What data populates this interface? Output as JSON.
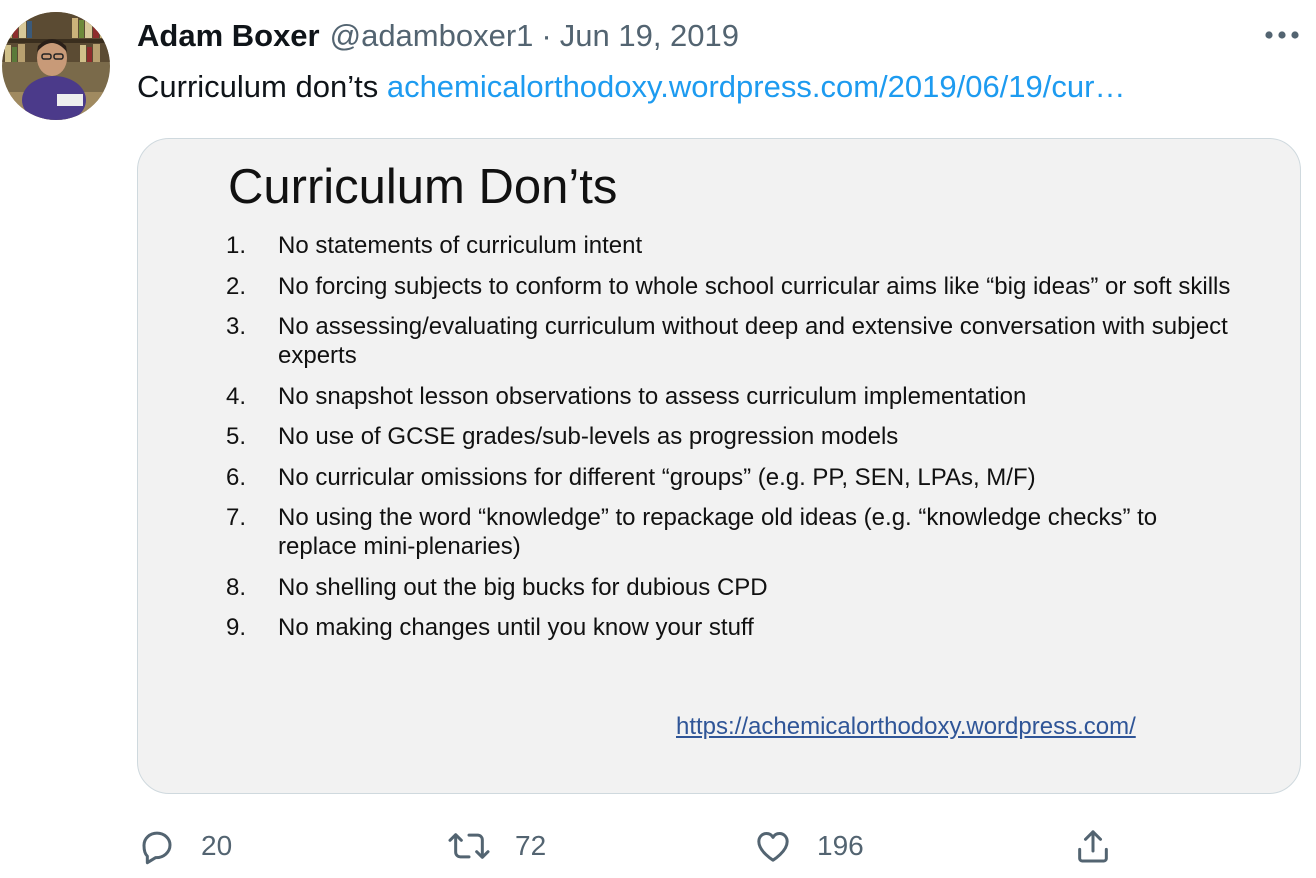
{
  "author": {
    "name": "Adam Boxer",
    "handle": "@adamboxer1",
    "separator": "·",
    "date": "Jun 19, 2019"
  },
  "tweet": {
    "text": "Curriculum don’ts",
    "link": "achemicalorthodoxy.wordpress.com/2019/06/19/cur…"
  },
  "media": {
    "title": "Curriculum Don’ts",
    "items": [
      {
        "num": "1.",
        "text": "No statements of curriculum intent"
      },
      {
        "num": "2.",
        "text": "No forcing subjects to conform to whole school curricular aims like “big ideas” or soft skills"
      },
      {
        "num": "3.",
        "text": "No assessing/evaluating curriculum without deep and extensive conversation with subject experts"
      },
      {
        "num": "4.",
        "text": "No snapshot lesson observations to assess curriculum implementation"
      },
      {
        "num": "5.",
        "text": "No use of GCSE grades/sub-levels as progression models"
      },
      {
        "num": "6.",
        "text": "No curricular omissions for different “groups” (e.g. PP, SEN, LPAs, M/F)"
      },
      {
        "num": "7.",
        "text": "No using the word “knowledge” to repackage old ideas (e.g. “knowledge checks” to replace mini-plenaries)"
      },
      {
        "num": "8.",
        "text": "No shelling out the big bucks for dubious CPD"
      },
      {
        "num": "9.",
        "text": "No making changes until you know your stuff"
      }
    ],
    "url": "https://achemicalorthodoxy.wordpress.com/"
  },
  "actions": {
    "replies": "20",
    "retweets": "72",
    "likes": "196"
  },
  "icons": {
    "reply": "reply-icon",
    "retweet": "retweet-icon",
    "like": "heart-icon",
    "share": "share-icon",
    "more": "more-icon"
  },
  "colors": {
    "link": "#1d9bf0",
    "secondary_text": "#536471",
    "card_background": "#f2f2f2",
    "slide_url": "#2f5597"
  }
}
